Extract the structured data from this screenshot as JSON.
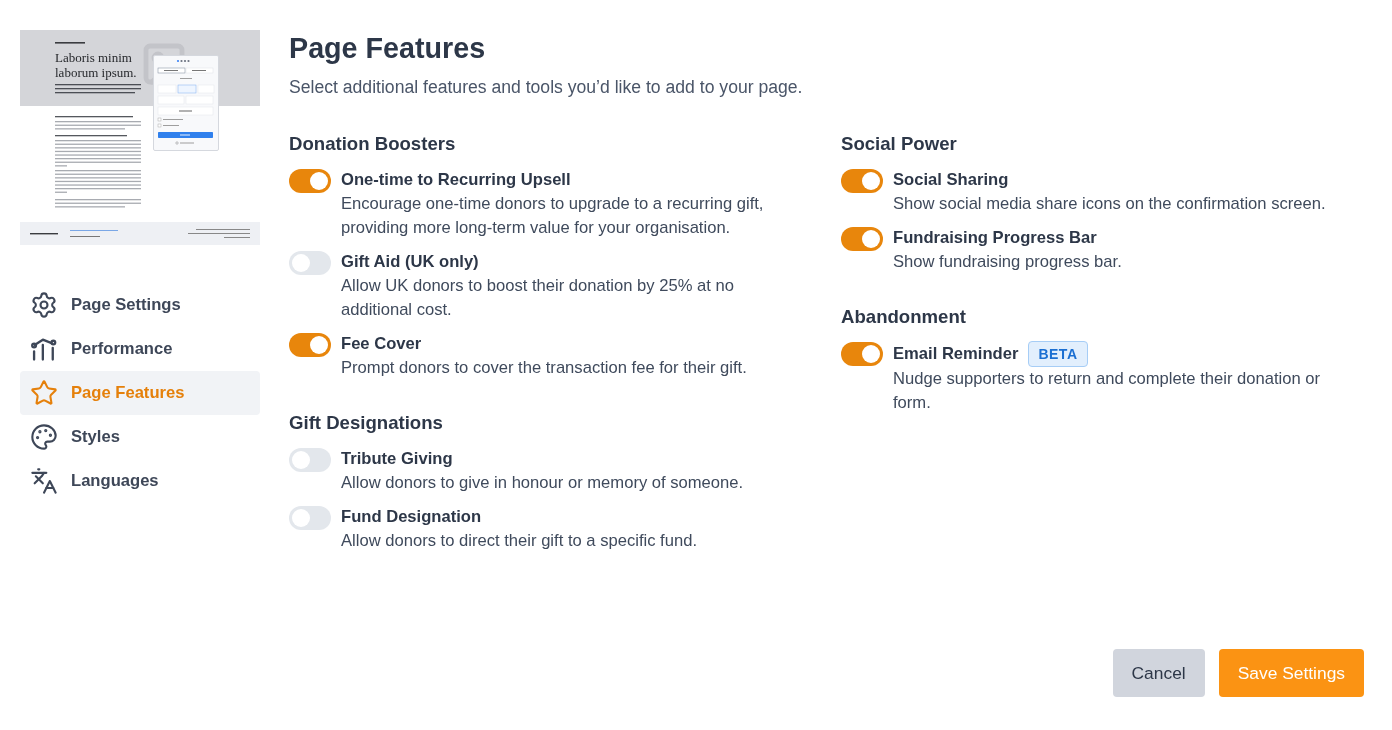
{
  "preview": {
    "heading": "Laboris minim laborum ipsum."
  },
  "sidebar": {
    "items": [
      {
        "label": "Page Settings",
        "selected": false
      },
      {
        "label": "Performance",
        "selected": false
      },
      {
        "label": "Page Features",
        "selected": true
      },
      {
        "label": "Styles",
        "selected": false
      },
      {
        "label": "Languages",
        "selected": false
      }
    ]
  },
  "header": {
    "title": "Page Features",
    "subtitle": "Select additional features and tools you’d like to add to your page."
  },
  "columns": [
    {
      "sections": [
        {
          "heading": "Donation Boosters",
          "features": [
            {
              "name": "One-time to Recurring Upsell",
              "description": "Encourage one-time donors to upgrade to a recurring gift, providing more long-term value for your organisation.",
              "on": true
            },
            {
              "name": "Gift Aid (UK only)",
              "description": "Allow UK donors to boost their donation by 25% at no additional cost.",
              "on": false
            },
            {
              "name": "Fee Cover",
              "description": "Prompt donors to cover the transaction fee for their gift.",
              "on": true
            }
          ]
        },
        {
          "heading": "Gift Designations",
          "features": [
            {
              "name": "Tribute Giving",
              "description": "Allow donors to give in honour or memory of someone.",
              "on": false
            },
            {
              "name": "Fund Designation",
              "description": "Allow donors to direct their gift to a specific fund.",
              "on": false
            }
          ]
        }
      ]
    },
    {
      "sections": [
        {
          "heading": "Social Power",
          "features": [
            {
              "name": "Social Sharing",
              "description": "Show social media share icons on the confirmation screen.",
              "on": true
            },
            {
              "name": "Fundraising Progress Bar",
              "description": "Show fundraising progress bar.",
              "on": true
            }
          ]
        },
        {
          "heading": "Abandonment",
          "features": [
            {
              "name": "Email Reminder",
              "badge": "BETA",
              "description": "Nudge supporters to return and complete their donation or form.",
              "on": true
            }
          ]
        }
      ]
    }
  ],
  "buttons": [
    {
      "label": "Cancel",
      "kind": "secondary"
    },
    {
      "label": "Save Settings",
      "kind": "primary"
    }
  ]
}
